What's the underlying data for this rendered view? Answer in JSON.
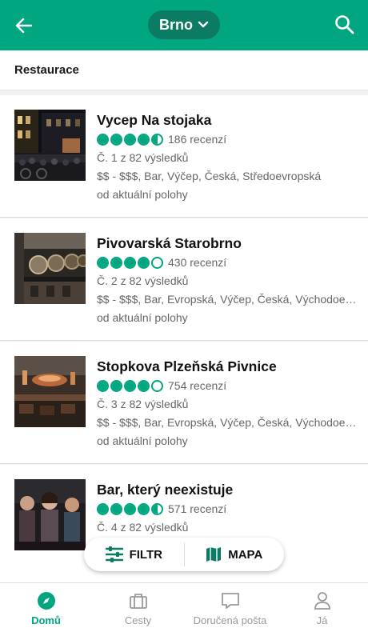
{
  "header": {
    "location": "Brno",
    "accent": "#00a680"
  },
  "section": {
    "title": "Restaurace"
  },
  "restaurants": [
    {
      "name": "Vycep Na stojaka",
      "rating": 4.5,
      "reviews": "186 recenzí",
      "rank": "Č. 1 z 82 výsledků",
      "cuisine": "$$ - $$$, Bar, Výčep, Česká, Středoevropská",
      "distance": "od aktuální polohy"
    },
    {
      "name": "Pivovarská Starobrno",
      "rating": 4.0,
      "reviews": "430 recenzí",
      "rank": "Č. 2 z 82 výsledků",
      "cuisine": "$$ - $$$, Bar, Evropská, Výčep, Česká, Východoe…",
      "distance": "od aktuální polohy"
    },
    {
      "name": "Stopkova Plzeňská Pivnice",
      "rating": 4.0,
      "reviews": "754 recenzí",
      "rank": "Č. 3 z 82 výsledků",
      "cuisine": "$$ - $$$, Bar, Evropská, Výčep, Česká, Východoe…",
      "distance": "od aktuální polohy"
    },
    {
      "name": "Bar, který neexistuje",
      "rating": 4.5,
      "reviews": "571 recenzí",
      "rank": "Č. 4 z 82 výsledků",
      "cuisine": "",
      "distance": ""
    }
  ],
  "fab": {
    "filter": "FILTR",
    "map": "MAPA"
  },
  "nav": [
    {
      "label": "Domů",
      "icon": "compass-icon",
      "active": true
    },
    {
      "label": "Cesty",
      "icon": "briefcase-icon",
      "active": false
    },
    {
      "label": "Doručená pošta",
      "icon": "chat-icon",
      "active": false
    },
    {
      "label": "Já",
      "icon": "person-icon",
      "active": false
    }
  ]
}
